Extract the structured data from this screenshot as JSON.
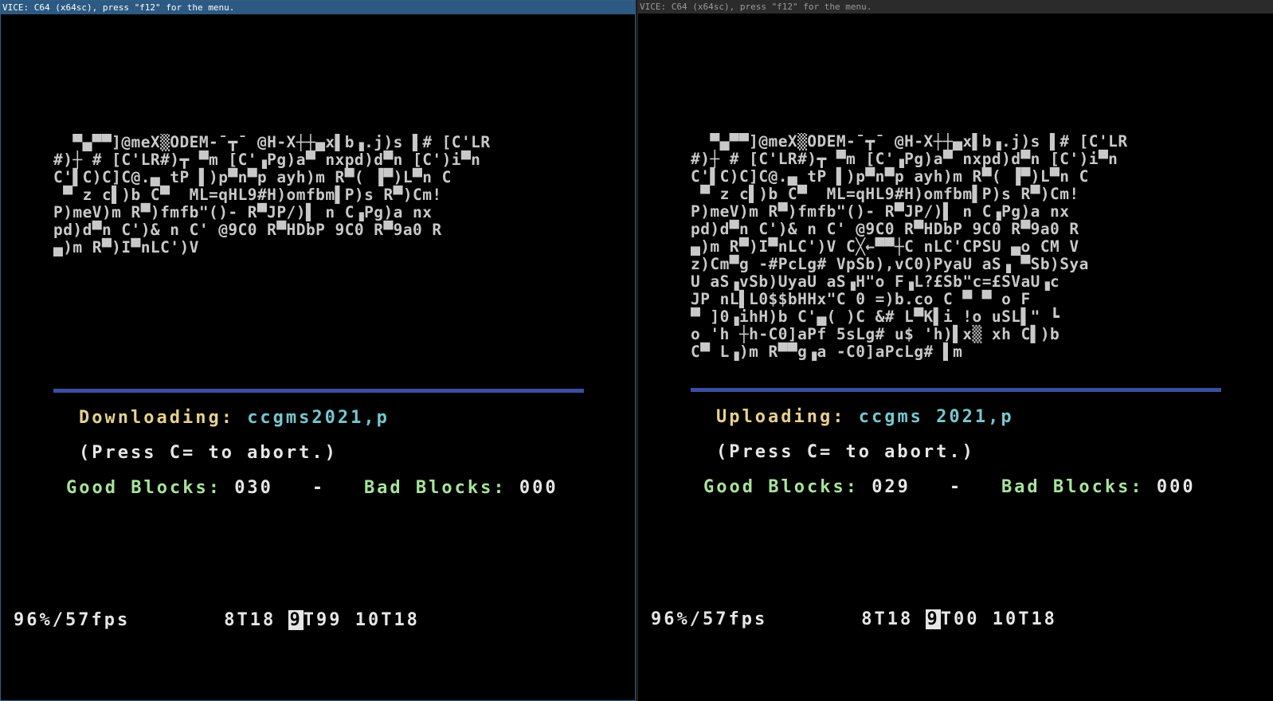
{
  "windows": [
    {
      "title": "VICE: C64 (x64sc), press \"f12\" for the menu.",
      "garbage_lines": [
        "  ▀▄▀▀]@meX▒ODEM-¯┳¯ @H-X┼┼▄x▌b▗.j)s ▌# [C'LR",
        "#)┼ # [C'LR#)┳ ▀m [C'▗Pg)a▀ nxpd)d▀n [C')i▀n",
        "C'▌C)C]C@.▄ tP ▌)p▀n▀p ayh)m R▀( ▐▀)L▀n C",
        " ▀ z c▌)b C▀  ML=qHL9#H)omfbm▌P)s R▀)Cm!",
        "P)meV)m R▀)fmfb\"()- R▀JP/)▌ n C▗Pg)a nx",
        "pd)d▀n C')& n C' @9C0 R▀HDbP 9C0 R▀9a0 R",
        "▄)m R▀)I▀nLC')V"
      ],
      "transfer_label": "Downloading: ",
      "filename": "ccgms2021,p",
      "abort_hint": "(Press C= to abort.)",
      "good_blocks_label": "Good Blocks: ",
      "good_blocks": "030",
      "dash": "-",
      "bad_blocks_label": "Bad Blocks: ",
      "bad_blocks": "000",
      "perf": "96%/57fps",
      "drive8": "8T18",
      "drive9_marker": "9",
      "drive9": "T99",
      "drive10": "10T18"
    },
    {
      "title": "VICE: C64 (x64sc), press \"f12\" for the menu.",
      "garbage_lines": [
        "  ▀▄▀▀]@meX▒ODEM-¯┳¯ @H-X┼┼▄x▌b▗.j)s ▌# [C'LR",
        "#)┼ # [C'LR#)┳ ▀m [C'▗Pg)a▀ nxpd)d▀n [C')i▀n",
        "C'▌C)C]C@.▄ tP ▌)p▀n▀p ayh)m R▀( ▐▀)L▀n C",
        " ▀ z c▌)b C▀  ML=qHL9#H)omfbm▌P)s R▀)Cm!",
        "P)meV)m R▀)fmfb\"()- R▀JP/)▌ n C▗Pg)a nx",
        "pd)d▀n C')& n C' @9C0 R▀HDbP 9C0 R▀9a0 R",
        "▄)m R▀)I▀nLC')V C╳←▀▀┼C nLC'CPSU ▄o CM V",
        "z)Cm▀g -#PcLg# VpSb),vC0)PyaU aS▗ ▀Sb)Sya",
        "U aS▗vSb)UyaU aS▗H\"o F▗L?£Sb\"c=£SVaU▗c",
        "JP nL▌L0$$bHHx\"C 0 =)b.co C ▀ ▀ o F",
        "▀ ]0▗ihH)b C'▄( )C &# L▀K▌i !o uSL▌\" ┗",
        "o 'h ┼h-C0]aPf 5sLg# u$ 'h)▌x▒ xh C▌)b",
        "C▀ L▗)m R▀▀g▗a -C0]aPcLg# ▌m"
      ],
      "transfer_label": "Uploading: ",
      "filename": "ccgms 2021,p",
      "abort_hint": "(Press C= to abort.)",
      "good_blocks_label": "Good Blocks: ",
      "good_blocks": "029",
      "dash": "-",
      "bad_blocks_label": "Bad Blocks: ",
      "bad_blocks": "000",
      "perf": "96%/57fps",
      "drive8": "8T18",
      "drive9_marker": "9",
      "drive9": "T00",
      "drive10": "10T18"
    }
  ],
  "colors": {
    "title_active_bg": "#2c5a82",
    "title_inactive_bg": "#2b2b2b",
    "c64_blue_bar": "#3a4fa3",
    "label_yellow": "#e8d08e",
    "filename_cyan": "#77c6cf",
    "blocks_green": "#a8e39b"
  }
}
